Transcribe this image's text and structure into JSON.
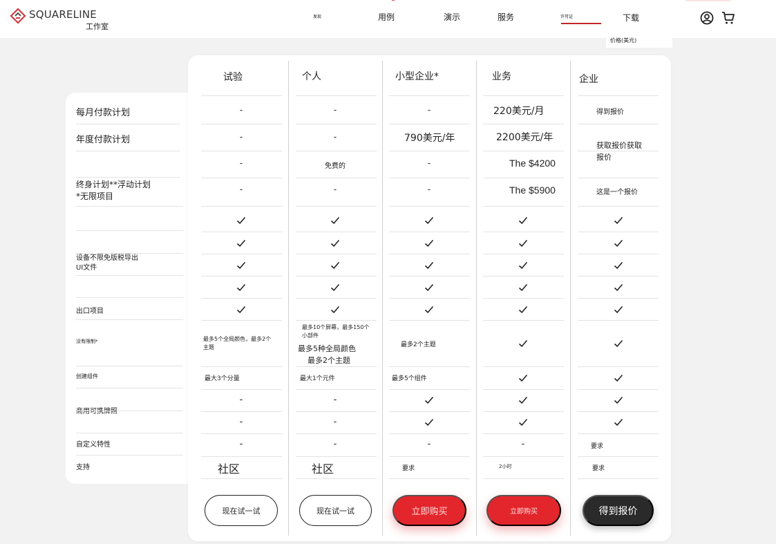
{
  "brand": {
    "name": "SQUARELINE",
    "sub": "工作室"
  },
  "nav": {
    "discover": "发现",
    "examples": "用例",
    "demo": "演示",
    "services": "服务",
    "license": "许可证",
    "download": "下载",
    "dropdown_item": "价格(美元)"
  },
  "colors": {
    "accent": "#e3262c",
    "dark_button": "#2a2a2a"
  },
  "plans": [
    {
      "name": "试验",
      "button": "现在试一试"
    },
    {
      "name": "个人",
      "button": "现在试一试"
    },
    {
      "name": "小型企业*",
      "button": "立即购买"
    },
    {
      "name": "业务",
      "button": "立即购买"
    },
    {
      "name": "企业",
      "button": "得到报价"
    }
  ],
  "features": {
    "monthly": "每月付款计划",
    "yearly": "年度付款计划",
    "lifetime": "终身计划**浮动计划*无限项目",
    "devices": "设备不限免版税导出UI文件",
    "export": "出口项目",
    "no_limit": "没有限制*",
    "create_components": "创建组件",
    "commercial": "商用可携牌照",
    "custom": "自定义特性",
    "support": "支持"
  },
  "cells": {
    "dash": "-",
    "tier3_month": "220美元/月",
    "tier2_year": "790美元/年",
    "tier3_year": "2200美元/年",
    "tier4_quote1": "得到报价",
    "tier4_quote2": "获取报价获取报价",
    "tier1_free": "免费的",
    "tier3_life1": "The $4200",
    "tier3_life2": "The $5900",
    "tier4_quote3": "这是一个报价",
    "tier0_theme": "最多5个全局颜色，最多2个主题",
    "tier1_screens": "最多10个屏幕，最多150个小部件",
    "tier1_colors": "最多5种全局颜色",
    "tier1_themes": "最多2个主题",
    "tier2_theme": "最多2个主题",
    "tier0_comp": "最大3个分量",
    "tier1_comp": "最大1个元件",
    "tier2_comp": "最多5个组件",
    "request": "要求",
    "community": "社区",
    "two_hours": "2小时"
  }
}
